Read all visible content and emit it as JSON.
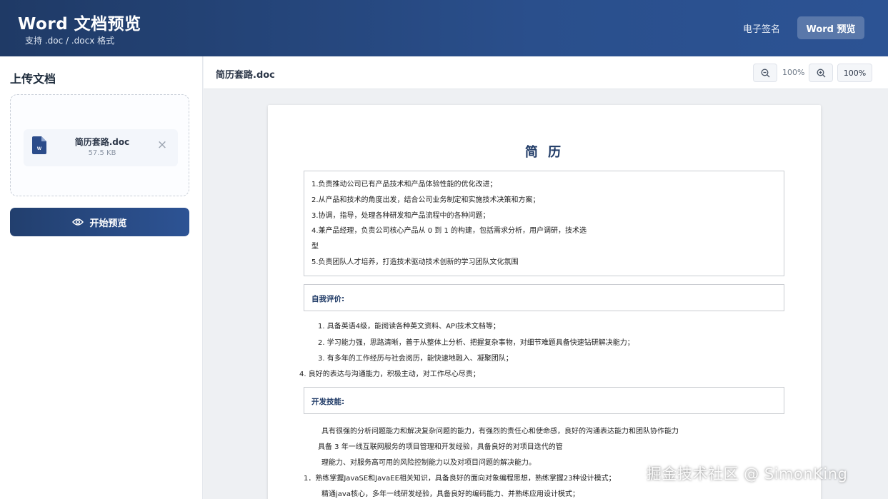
{
  "header": {
    "title": "Word 文档预览",
    "subtitle": "支持 .doc / .docx 格式",
    "nav_sign": "电子签名",
    "nav_word": "Word 预览"
  },
  "sidebar": {
    "title": "上传文档",
    "file": {
      "name": "简历套路.doc",
      "size": "57.5 KB",
      "icon_text": "W"
    },
    "preview_button": "开始预览"
  },
  "viewer": {
    "doc_name": "简历套路.doc",
    "zoom_level": "100%",
    "zoom_reset": "100%"
  },
  "document": {
    "title": "简 历",
    "duties": [
      "1.负责推动公司已有产品技术和产品体验性能的优化改进；",
      "2.从产品和技术的角度出发，结合公司业务制定和实施技术决策和方案；",
      "3.协调，指导，处理各种研发和产品流程中的各种问题；",
      "4.兼产品经理，负责公司核心产品从 0 到 1 的构建，包括需求分析，用户调研，技术选",
      "型",
      "5.负责团队人才培养，打造技术驱动技术创新的学习团队文化氛围"
    ],
    "self_eval_heading": "自我评价:",
    "self_eval": [
      "1. 具备英语4级，能阅读各种英文资料、API技术文档等；",
      "2. 学习能力强，思路清晰，善于从整体上分析、把握复杂事物，对细节难题具备快速钻研解决能力；",
      "3. 有多年的工作经历与社会阅历，能快速地融入、凝聚团队；",
      "4. 良好的表达与沟通能力，积极主动，对工作尽心尽责；"
    ],
    "skills_heading": "开发技能:",
    "skills": [
      "具有很强的分析问题能力和解决复杂问题的能力，有强烈的责任心和使命感，良好的沟通表达能力和团队协作能力",
      "具备 3 年一线互联网服务的项目管理和开发经验，具备良好的对项目迭代的管",
      "理能力、对服务高可用的风险控制能力以及对项目问题的解决能力。",
      "1．熟练掌握JavaSE和JavaEE相关知识，具备良好的面向对象编程思想，熟练掌握23种设计模式；",
      "精通java核心，多年一线研发经验，具备良好的编码能力、并熟练应用设计模式；"
    ]
  },
  "watermark": "掘金技术社区 @ SimonKing"
}
